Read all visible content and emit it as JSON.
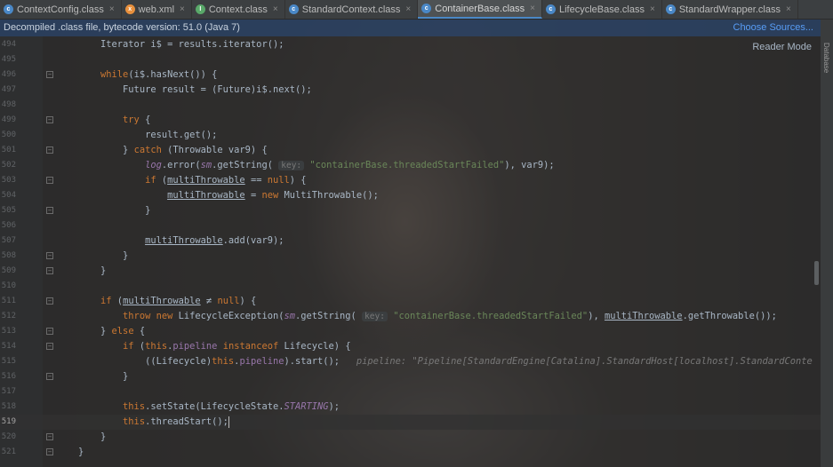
{
  "tabs": [
    {
      "label": "ContextConfig.class",
      "icon": "class-icon",
      "color": "#4a88c7",
      "glyph": "c",
      "active": false
    },
    {
      "label": "web.xml",
      "icon": "xml-icon",
      "color": "#e8903d",
      "glyph": "x",
      "active": false
    },
    {
      "label": "Context.class",
      "icon": "interface-icon",
      "color": "#59a869",
      "glyph": "I",
      "active": false
    },
    {
      "label": "StandardContext.class",
      "icon": "class-icon",
      "color": "#4a88c7",
      "glyph": "c",
      "active": false
    },
    {
      "label": "ContainerBase.class",
      "icon": "abstract-class-icon",
      "color": "#4a88c7",
      "glyph": "c",
      "active": true
    },
    {
      "label": "LifecycleBase.class",
      "icon": "abstract-class-icon",
      "color": "#4a88c7",
      "glyph": "c",
      "active": false
    },
    {
      "label": "StandardWrapper.class",
      "icon": "class-icon",
      "color": "#4a88c7",
      "glyph": "c",
      "active": false
    }
  ],
  "banner": {
    "message": "Decompiled .class file, bytecode version: 51.0 (Java 7)",
    "choose_sources": "Choose Sources..."
  },
  "reader_mode": "Reader Mode",
  "side_strip_label": "Database",
  "code_lines": [
    {
      "n": "494",
      "html": "    Iterator i$ = results.iterator();"
    },
    {
      "n": "495",
      "html": ""
    },
    {
      "n": "496",
      "html": "    <span class=\"kw\">while</span>(i$.hasNext()) {"
    },
    {
      "n": "497",
      "html": "        Future result = (Future)i$.next();"
    },
    {
      "n": "498",
      "html": ""
    },
    {
      "n": "499",
      "html": "        <span class=\"kw\">try</span> {"
    },
    {
      "n": "500",
      "html": "            result.get();"
    },
    {
      "n": "501",
      "html": "        } <span class=\"kw\">catch</span> (Throwable var9) {"
    },
    {
      "n": "502",
      "html": "            <span class=\"sfld\">log</span>.error(<span class=\"sfld\">sm</span>.getString( <span class=\"hint\">key:</span> <span class=\"str\">\"containerBase.threadedStartFailed\"</span>), var9);"
    },
    {
      "n": "503",
      "html": "            <span class=\"kw\">if</span> (<span class=\"ul\">multiThrowable</span> == <span class=\"kw\">null</span>) {"
    },
    {
      "n": "504",
      "html": "                <span class=\"ul\">multiThrowable</span> = <span class=\"kw\">new</span> MultiThrowable();"
    },
    {
      "n": "505",
      "html": "            }"
    },
    {
      "n": "506",
      "html": ""
    },
    {
      "n": "507",
      "html": "            <span class=\"ul\">multiThrowable</span>.add(var9);"
    },
    {
      "n": "508",
      "html": "        }"
    },
    {
      "n": "509",
      "html": "    }"
    },
    {
      "n": "510",
      "html": ""
    },
    {
      "n": "511",
      "html": "    <span class=\"kw\">if</span> (<span class=\"ul\">multiThrowable</span> ≠ <span class=\"kw\">null</span>) {"
    },
    {
      "n": "512",
      "html": "        <span class=\"kw\">throw new</span> LifecycleException(<span class=\"sfld\">sm</span>.getString( <span class=\"hint\">key:</span> <span class=\"str\">\"containerBase.threadedStartFailed\"</span>), <span class=\"ul\">multiThrowable</span>.getThrowable());"
    },
    {
      "n": "513",
      "html": "    } <span class=\"kw\">else</span> {"
    },
    {
      "n": "514",
      "html": "        <span class=\"kw\">if</span> (<span class=\"kw\">this</span>.<span class=\"fld\">pipeline</span> <span class=\"kw\">instanceof</span> Lifecycle) {"
    },
    {
      "n": "515",
      "html": "            ((Lifecycle)<span class=\"kw\">this</span>.<span class=\"fld\">pipeline</span>).start();   <span class=\"inl\">pipeline: \"Pipeline[StandardEngine[Catalina].StandardHost[localhost].StandardConte</span>"
    },
    {
      "n": "516",
      "html": "        }"
    },
    {
      "n": "517",
      "html": ""
    },
    {
      "n": "518",
      "html": "        <span class=\"kw\">this</span>.setState(LifecycleState.<span class=\"sfld\">STARTING</span>);"
    },
    {
      "n": "519",
      "html": "        <span class=\"kw\">this</span>.threadStart();<span class=\"caret\"></span>",
      "current": true
    },
    {
      "n": "520",
      "html": "    }"
    },
    {
      "n": "521",
      "html": "}"
    }
  ]
}
